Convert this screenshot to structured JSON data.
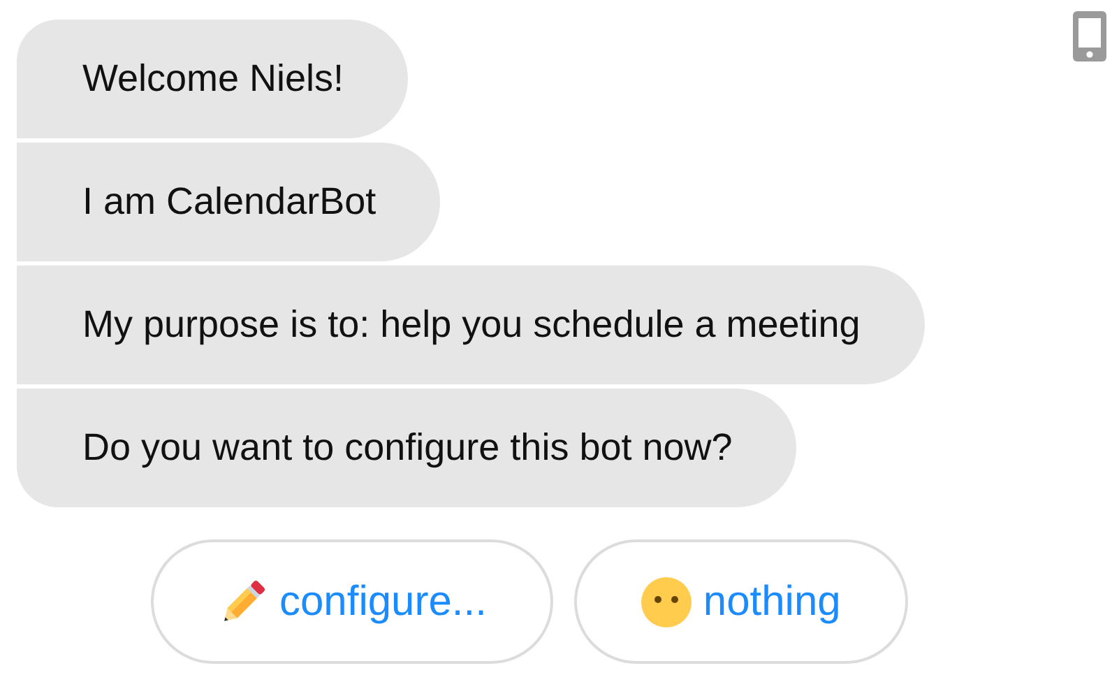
{
  "messages": [
    {
      "text": "Welcome Niels!"
    },
    {
      "text": "I am CalendarBot"
    },
    {
      "text": "My purpose is to: help you schedule a meeting"
    },
    {
      "text": "Do you want to configure this bot now?"
    }
  ],
  "quick_replies": [
    {
      "label": "configure...",
      "kind": "edit"
    },
    {
      "label": "nothing",
      "kind": "dismiss"
    }
  ]
}
